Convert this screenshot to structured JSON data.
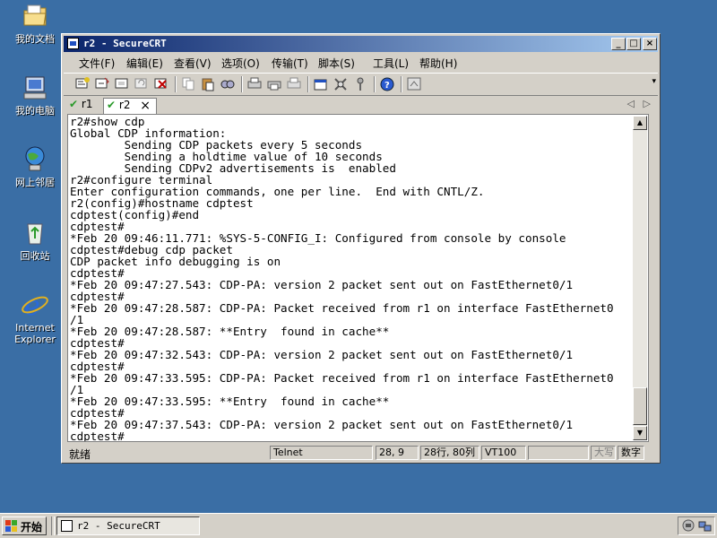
{
  "desktop": {
    "icons": [
      {
        "label": "我的文档",
        "icon": "my-documents-icon"
      },
      {
        "label": "我的电脑",
        "icon": "my-computer-icon"
      },
      {
        "label": "网上邻居",
        "icon": "network-places-icon"
      },
      {
        "label": "回收站",
        "icon": "recycle-bin-icon"
      },
      {
        "label": "Internet Explorer",
        "icon": "internet-explorer-icon"
      }
    ]
  },
  "window": {
    "title": "r2 - SecureCRT",
    "controls": {
      "minimize": "_",
      "maximize": "□",
      "close": "×"
    }
  },
  "menu": [
    {
      "label": "文件(F)"
    },
    {
      "label": "编辑(E)"
    },
    {
      "label": "查看(V)"
    },
    {
      "label": "选项(O)"
    },
    {
      "label": "传输(T)"
    },
    {
      "label": "脚本(S)"
    },
    {
      "label": "工具(L)"
    },
    {
      "label": "帮助(H)"
    }
  ],
  "tabs": [
    {
      "label": "r1",
      "active": false
    },
    {
      "label": "r2",
      "active": true
    }
  ],
  "tab_close": "×",
  "tab_nav": {
    "left": "◁",
    "right": "▷"
  },
  "terminal": {
    "lines": [
      "r2#show cdp",
      "Global CDP information:",
      "        Sending CDP packets every 5 seconds",
      "        Sending a holdtime value of 10 seconds",
      "        Sending CDPv2 advertisements is  enabled",
      "r2#configure terminal",
      "Enter configuration commands, one per line.  End with CNTL/Z.",
      "r2(config)#hostname cdptest",
      "cdptest(config)#end",
      "cdptest#",
      "*Feb 20 09:46:11.771: %SYS-5-CONFIG_I: Configured from console by console",
      "cdptest#debug cdp packet",
      "CDP packet info debugging is on",
      "cdptest#",
      "*Feb 20 09:47:27.543: CDP-PA: version 2 packet sent out on FastEthernet0/1",
      "cdptest#",
      "*Feb 20 09:47:28.587: CDP-PA: Packet received from r1 on interface FastEthernet0",
      "/1",
      "*Feb 20 09:47:28.587: **Entry  found in cache**",
      "cdptest#",
      "*Feb 20 09:47:32.543: CDP-PA: version 2 packet sent out on FastEthernet0/1",
      "cdptest#",
      "*Feb 20 09:47:33.595: CDP-PA: Packet received from r1 on interface FastEthernet0",
      "/1",
      "*Feb 20 09:47:33.595: **Entry  found in cache**",
      "cdptest#",
      "*Feb 20 09:47:37.543: CDP-PA: version 2 packet sent out on FastEthernet0/1",
      "cdptest#"
    ]
  },
  "status": {
    "ready": "就绪",
    "protocol": "Telnet",
    "cursor": "28,  9",
    "size": "28行, 80列",
    "emulation": "VT100",
    "empty": "",
    "caps": "大写",
    "num": "数字"
  },
  "taskbar": {
    "start_label": "开始",
    "task_label": "r2 - SecureCRT"
  }
}
